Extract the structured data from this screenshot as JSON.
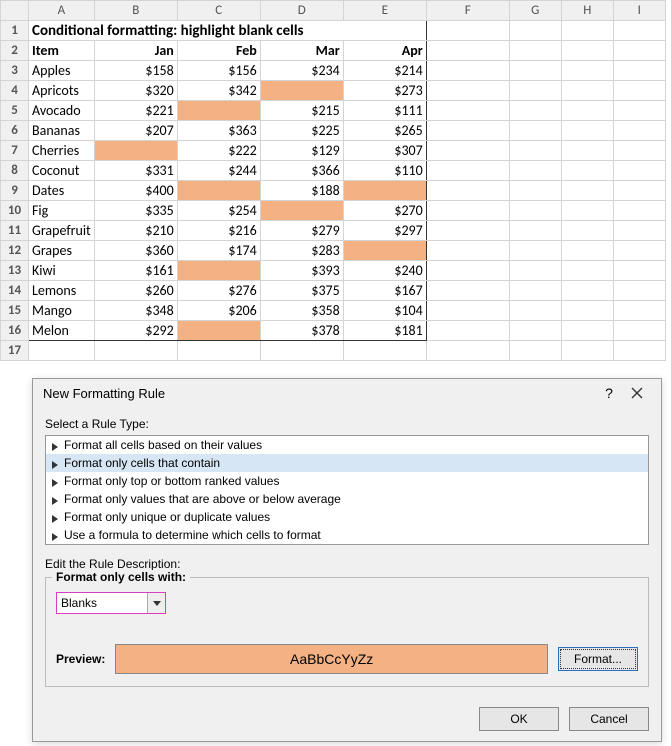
{
  "sheet": {
    "title": "Conditional formatting: highlight blank cells",
    "columns": [
      "A",
      "B",
      "C",
      "D",
      "E",
      "F",
      "G",
      "H",
      "I"
    ],
    "headers": {
      "item": "Item",
      "months": [
        "Jan",
        "Feb",
        "Mar",
        "Apr"
      ]
    },
    "rows": [
      {
        "name": "Apples",
        "vals": [
          "$158",
          "$156",
          "$234",
          "$214"
        ]
      },
      {
        "name": "Apricots",
        "vals": [
          "$320",
          "$342",
          "",
          "$273"
        ]
      },
      {
        "name": "Avocado",
        "vals": [
          "$221",
          "",
          "$215",
          "$111"
        ]
      },
      {
        "name": "Bananas",
        "vals": [
          "$207",
          "$363",
          "$225",
          "$265"
        ]
      },
      {
        "name": "Cherries",
        "vals": [
          "",
          "$222",
          "$129",
          "$307"
        ]
      },
      {
        "name": "Coconut",
        "vals": [
          "$331",
          "$244",
          "$366",
          "$110"
        ]
      },
      {
        "name": "Dates",
        "vals": [
          "$400",
          "",
          "$188",
          ""
        ]
      },
      {
        "name": "Fig",
        "vals": [
          "$335",
          "$254",
          "",
          "$270"
        ]
      },
      {
        "name": "Grapefruit",
        "vals": [
          "$210",
          "$216",
          "$279",
          "$297"
        ]
      },
      {
        "name": "Grapes",
        "vals": [
          "$360",
          "$174",
          "$283",
          ""
        ]
      },
      {
        "name": "Kiwi",
        "vals": [
          "$161",
          "",
          "$393",
          "$240"
        ]
      },
      {
        "name": "Lemons",
        "vals": [
          "$260",
          "$276",
          "$375",
          "$167"
        ]
      },
      {
        "name": "Mango",
        "vals": [
          "$348",
          "$206",
          "$358",
          "$104"
        ]
      },
      {
        "name": "Melon",
        "vals": [
          "$292",
          "",
          "$378",
          "$181"
        ]
      }
    ]
  },
  "dialog": {
    "title": "New Formatting Rule",
    "selectRuleLabel": "Select a Rule Type:",
    "rules": [
      "Format all cells based on their values",
      "Format only cells that contain",
      "Format only top or bottom ranked values",
      "Format only values that are above or below average",
      "Format only unique or duplicate values",
      "Use a formula to determine which cells to format"
    ],
    "selectedRuleIndex": 1,
    "editLabel": "Edit the Rule Description:",
    "groupLegend": "Format only cells with:",
    "comboValue": "Blanks",
    "previewLabel": "Preview:",
    "previewSample": "AaBbCcYyZz",
    "formatBtn": "Format...",
    "okBtn": "OK",
    "cancelBtn": "Cancel"
  },
  "chart_data": {
    "type": "table",
    "title": "Conditional formatting: highlight blank cells",
    "columns": [
      "Item",
      "Jan",
      "Feb",
      "Mar",
      "Apr"
    ],
    "rows": [
      [
        "Apples",
        158,
        156,
        234,
        214
      ],
      [
        "Apricots",
        320,
        342,
        null,
        273
      ],
      [
        "Avocado",
        221,
        null,
        215,
        111
      ],
      [
        "Bananas",
        207,
        363,
        225,
        265
      ],
      [
        "Cherries",
        null,
        222,
        129,
        307
      ],
      [
        "Coconut",
        331,
        244,
        366,
        110
      ],
      [
        "Dates",
        400,
        null,
        188,
        null
      ],
      [
        "Fig",
        335,
        254,
        null,
        270
      ],
      [
        "Grapefruit",
        210,
        216,
        279,
        297
      ],
      [
        "Grapes",
        360,
        174,
        283,
        null
      ],
      [
        "Kiwi",
        161,
        null,
        393,
        240
      ],
      [
        "Lemons",
        260,
        276,
        375,
        167
      ],
      [
        "Mango",
        348,
        206,
        358,
        104
      ],
      [
        "Melon",
        292,
        null,
        378,
        181
      ]
    ],
    "currency": "USD",
    "highlight_rule": "blank cells filled with #f4b183"
  }
}
